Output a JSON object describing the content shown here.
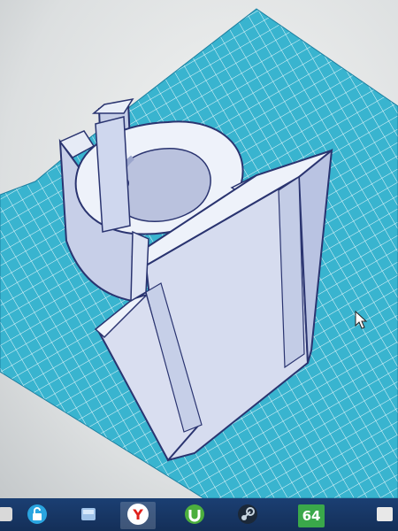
{
  "app": {
    "viewport": "3d-design-workplane",
    "colors": {
      "grid_fill": "#39b4cf",
      "grid_line": "#e7f7fb",
      "model_light": "#e8edf7",
      "model_mid": "#c9d2ea",
      "model_dark": "#a9b5d8",
      "model_edge": "#2a3470",
      "taskbar": "#1b3f73"
    }
  },
  "cursor": {
    "icon": "mouse-pointer-icon"
  },
  "taskbar": {
    "items": [
      {
        "icon": "unknown-app-icon"
      },
      {
        "icon": "lock-app-icon"
      },
      {
        "icon": "drive-app-icon"
      },
      {
        "icon": "yandex-browser-icon",
        "label": "Y"
      },
      {
        "icon": "utorrent-icon"
      },
      {
        "icon": "steam-icon"
      },
      {
        "icon": "aida64-icon",
        "label": "64"
      },
      {
        "icon": "partial-app-icon"
      }
    ]
  }
}
